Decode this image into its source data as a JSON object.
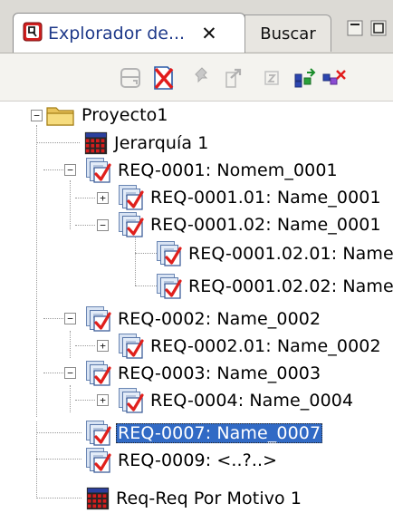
{
  "tabs": [
    {
      "label": "Explorador de...",
      "active": true,
      "close": "✕"
    },
    {
      "label": "Buscar",
      "active": false
    }
  ],
  "view_controls": [
    "minimize-icon",
    "maximize-icon"
  ],
  "toolbar": {
    "buttons": [
      "database-icon",
      "delete-icon",
      "pin-icon",
      "export-icon",
      "refresh-icon",
      "link-icon",
      "unlink-icon"
    ]
  },
  "tree": [
    {
      "label": "Proyecto1",
      "icon": "folder-icon",
      "expanded": true
    },
    {
      "label": "Jerarquía 1",
      "icon": "hierarchy-icon"
    },
    {
      "label": "REQ-0001: Nomem_0001",
      "icon": "requirement-icon",
      "expanded": true
    },
    {
      "label": "REQ-0001.01: Name_0001",
      "icon": "requirement-icon",
      "expanded": false
    },
    {
      "label": "REQ-0001.02: Name_0001",
      "icon": "requirement-icon",
      "expanded": true
    },
    {
      "label": "REQ-0001.02.01: Name",
      "icon": "requirement-icon"
    },
    {
      "label": "REQ-0001.02.02: Name",
      "icon": "requirement-icon"
    },
    {
      "label": "REQ-0002: Name_0002",
      "icon": "requirement-icon",
      "expanded": true
    },
    {
      "label": "REQ-0002.01: Name_0002",
      "icon": "requirement-icon",
      "expanded": false
    },
    {
      "label": "REQ-0003: Name_0003",
      "icon": "requirement-icon",
      "expanded": true
    },
    {
      "label": "REQ-0004: Name_0004",
      "icon": "requirement-icon",
      "expanded": false
    },
    {
      "label": "REQ-0007: Name_0007",
      "icon": "requirement-icon",
      "selected": true
    },
    {
      "label": "REQ-0009: <..?..>",
      "icon": "requirement-icon"
    },
    {
      "label": "Req-Req Por Motivo 1",
      "icon": "hierarchy-icon"
    }
  ],
  "colors": {
    "selection": "#316ac5",
    "tab_text": "#1f3a8a",
    "check": "#e0201c"
  }
}
